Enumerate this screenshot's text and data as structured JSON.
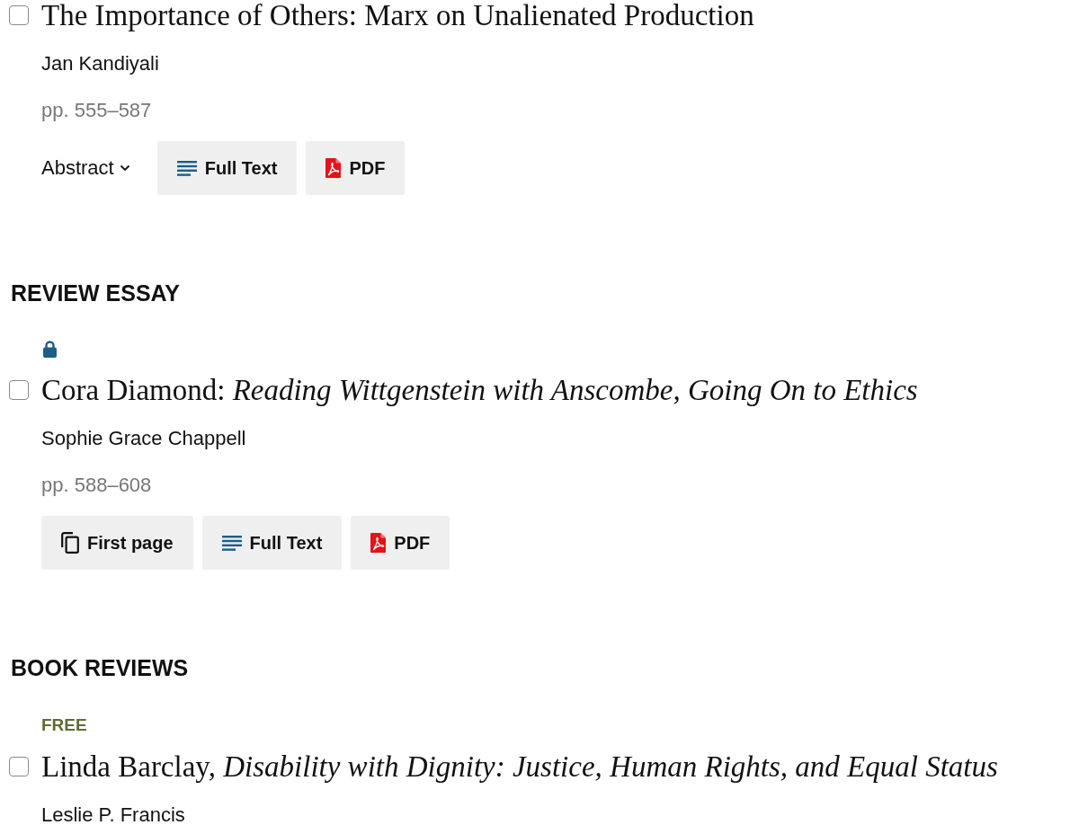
{
  "groups": [
    {
      "articles": [
        {
          "checked": false,
          "title": "The Importance of Others: Marx on Unalienated Production",
          "authors": "Jan Kandiyali",
          "pages": "pp. 555–587",
          "abstract": {
            "label": "Abstract",
            "expanded": false
          },
          "buttons": [
            {
              "kind": "full_text",
              "label": "Full Text"
            },
            {
              "kind": "pdf",
              "label": "PDF"
            }
          ]
        }
      ]
    },
    {
      "heading": "REVIEW ESSAY",
      "articles": [
        {
          "access": {
            "kind": "locked"
          },
          "checked": false,
          "title": "Cora Diamond: *Reading Wittgenstein with Anscombe, Going On to Ethics*",
          "authors": "Sophie Grace Chappell",
          "pages": "pp. 588–608",
          "buttons": [
            {
              "kind": "first_page",
              "label": "First page"
            },
            {
              "kind": "full_text",
              "label": "Full Text"
            },
            {
              "kind": "pdf",
              "label": "PDF"
            }
          ]
        }
      ]
    },
    {
      "heading": "BOOK REVIEWS",
      "articles": [
        {
          "access": {
            "kind": "free",
            "label": "FREE"
          },
          "checked": false,
          "title": "Linda Barclay, *Disability with Dignity: Justice, Human Rights, and Equal Status*",
          "authors": "Leslie P. Francis"
        }
      ]
    }
  ]
}
